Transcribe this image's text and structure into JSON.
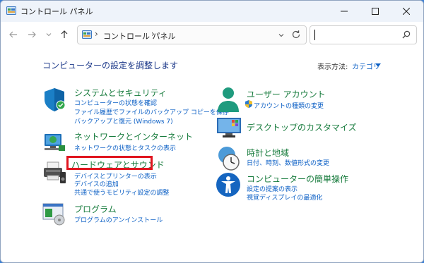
{
  "window": {
    "title": "コントロール パネル"
  },
  "address": {
    "crumb": "コントロール パネル"
  },
  "search": {
    "placeholder": "",
    "value": ""
  },
  "main": {
    "title": "コンピューターの設定を調整します",
    "view_label": "表示方法:",
    "view_value": "カテゴリ"
  },
  "categories": {
    "security": {
      "title": "システムとセキュリティ",
      "links": [
        "コンピューターの状態を確認",
        "ファイル履歴でファイルのバックアップ コピーを保存",
        "バックアップと復元 (Windows 7)"
      ]
    },
    "network": {
      "title": "ネットワークとインターネット",
      "links": [
        "ネットワークの状態とタスクの表示"
      ]
    },
    "hardware": {
      "title": "ハードウェアとサウンド",
      "links": [
        "デバイスとプリンターの表示",
        "デバイスの追加",
        "共通で使うモビリティ設定の調整"
      ]
    },
    "programs": {
      "title": "プログラム",
      "links": [
        "プログラムのアンインストール"
      ]
    },
    "users": {
      "title": "ユーザー アカウント",
      "links": [
        "アカウントの種類の変更"
      ]
    },
    "desktop": {
      "title": "デスクトップのカスタマイズ",
      "links": []
    },
    "clock": {
      "title": "時計と地域",
      "links": [
        "日付、時刻、数値形式の変更"
      ]
    },
    "ease": {
      "title": "コンピューターの簡単操作",
      "links": [
        "設定の提案の表示",
        "視覚ディスプレイの最適化"
      ]
    }
  },
  "colors": {
    "category_title": "#157a3b",
    "link": "#0b5fc5",
    "highlight": "#e0151f",
    "heading": "#1e3a8a"
  }
}
